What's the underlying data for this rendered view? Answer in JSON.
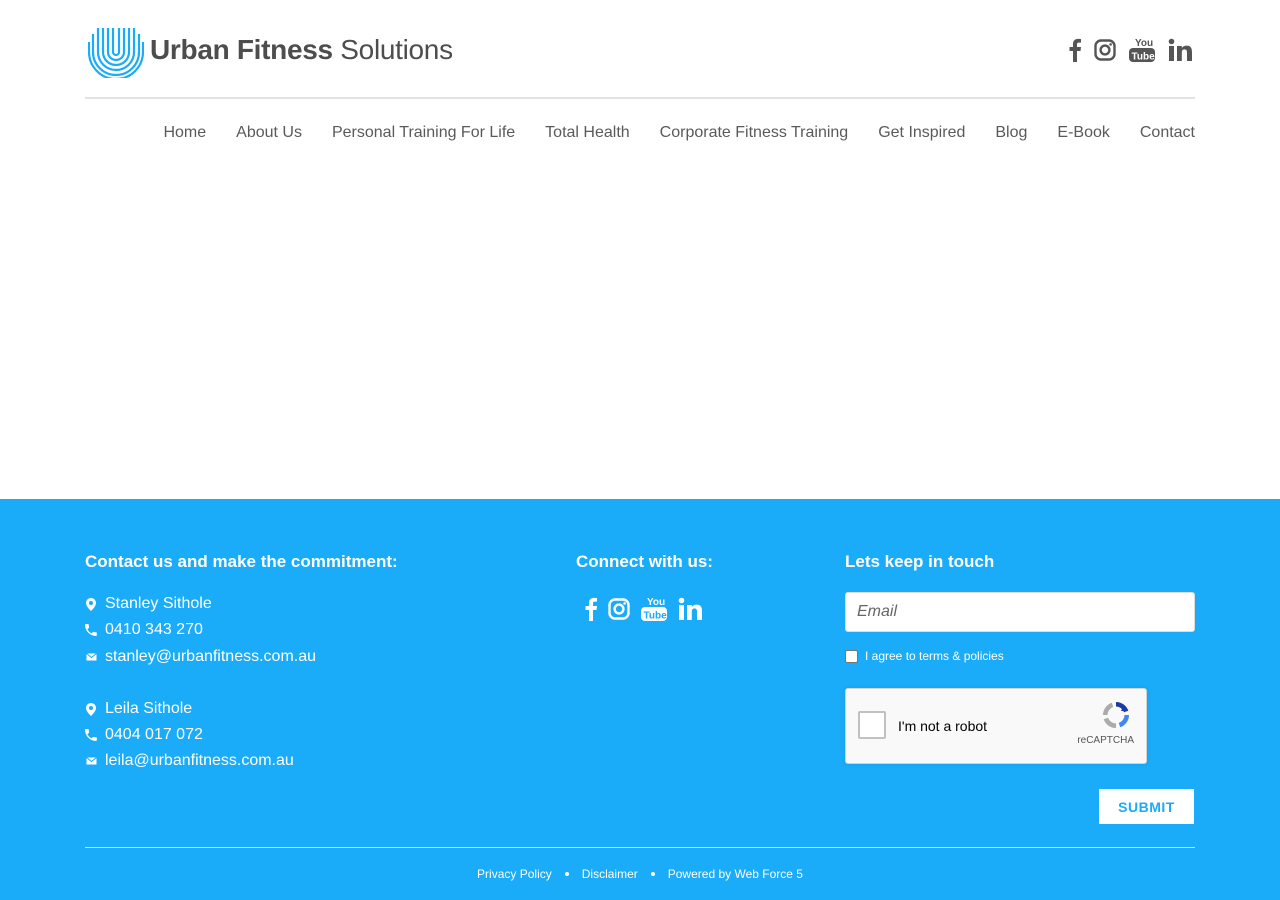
{
  "brand": {
    "name_bold": "Urban Fitness",
    "name_light": " Solutions",
    "accent_color": "#1aabf9"
  },
  "header_social": [
    {
      "icon": "facebook-icon"
    },
    {
      "icon": "instagram-icon"
    },
    {
      "icon": "youtube-icon"
    },
    {
      "icon": "linkedin-icon"
    }
  ],
  "nav": {
    "items": [
      "Home",
      "About Us",
      "Personal Training For Life",
      "Total Health",
      "Corporate Fitness Training",
      "Get Inspired",
      "Blog",
      "E-Book",
      "Contact"
    ]
  },
  "footer": {
    "contact_title": "Contact us and make the commitment:",
    "contacts": [
      {
        "name": "Stanley Sithole",
        "phone": "0410 343 270",
        "email": "stanley@urbanfitness.com.au"
      },
      {
        "name": "Leila Sithole",
        "phone": "0404 017 072",
        "email": "leila@urbanfitness.com.au"
      }
    ],
    "connect_title": "Connect with us:",
    "newsletter_title": "Lets keep in touch",
    "email_placeholder": "Email",
    "agree_label": "I agree to terms & policies",
    "recaptcha_label": "I'm not a robot",
    "recaptcha_brand": "reCAPTCHA",
    "submit_label": "SUBMIT",
    "links": {
      "privacy": "Privacy Policy",
      "disclaimer": "Disclaimer",
      "powered": "Powered by Web Force 5"
    }
  }
}
